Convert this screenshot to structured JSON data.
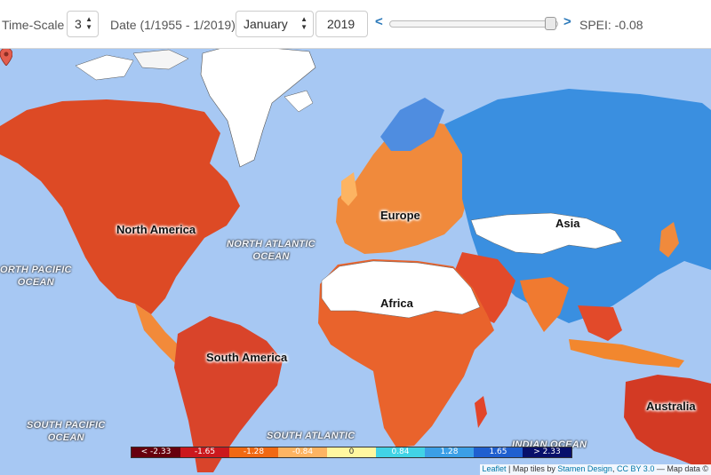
{
  "controls": {
    "time_scale_label": "Time-Scale",
    "time_scale_value": "3",
    "date_label": "Date (1/1955 - 1/2019)",
    "month_value": "January",
    "year_value": "2019",
    "spei_readout": "SPEI: -0.08",
    "prev_icon": "chevron-left-icon",
    "slider_fraction": 0.99
  },
  "map": {
    "continents": [
      "North America",
      "South America",
      "Europe",
      "Africa",
      "Asia",
      "Australia"
    ],
    "oceans": [
      "NORTH ATLANTIC OCEAN",
      "NORTH PACIFIC OCEAN",
      "SOUTH PACIFIC OCEAN",
      "SOUTH ATLANTIC OCEAN",
      "INDIAN OCEAN"
    ],
    "ocean_lines": {
      "north_atlantic": [
        "NORTH ATLANTIC",
        "OCEAN"
      ],
      "north_pacific": [
        "ORTH PACIFIC",
        "OCEAN"
      ],
      "south_pacific": [
        "SOUTH PACIFIC",
        "OCEAN"
      ],
      "south_atlantic": [
        "SOUTH ATLANTIC"
      ],
      "indian": [
        "INDIAN OCEAN"
      ]
    },
    "marker_icon": "map-pin-icon",
    "colors": {
      "water": "#a7c8f3",
      "no_data": "#ffffff"
    }
  },
  "legend": {
    "bins": [
      {
        "label": "< -2.33",
        "color": "#67000d",
        "text": "#ffffff"
      },
      {
        "label": "-1.65",
        "color": "#cb181d",
        "text": "#ffffff"
      },
      {
        "label": "-1.28",
        "color": "#f16913",
        "text": "#ffffff"
      },
      {
        "label": "-0.84",
        "color": "#fdb462",
        "text": "#ffffff"
      },
      {
        "label": "0",
        "color": "#fff7a0",
        "text": "#333333"
      },
      {
        "label": "0.84",
        "color": "#41d3e6",
        "text": "#ffffff"
      },
      {
        "label": "1.28",
        "color": "#3b9fe6",
        "text": "#ffffff"
      },
      {
        "label": "1.65",
        "color": "#1f5fcf",
        "text": "#ffffff"
      },
      {
        "label": "> 2.33",
        "color": "#08106b",
        "text": "#ffffff"
      }
    ]
  },
  "attribution": {
    "leaflet": "Leaflet",
    "text": " | Map tiles by ",
    "stamen": "Stamen Design",
    "sep": ", ",
    "license": "CC BY 3.0",
    "tail": " — Map data ©"
  }
}
